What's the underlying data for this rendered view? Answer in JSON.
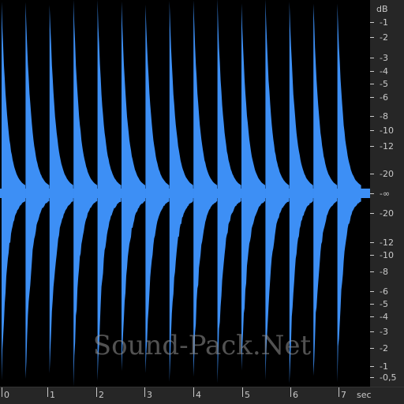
{
  "waveform": {
    "color": "#3d8ff5",
    "background": "#000000",
    "beat_count": 15
  },
  "db_ruler": {
    "unit": "dB",
    "labels": [
      "-1",
      "-2",
      "-3",
      "-4",
      "-5",
      "-6",
      "-8",
      "-10",
      "-12",
      "-20",
      "-∞",
      "-20",
      "-12",
      "-10",
      "-8",
      "-6",
      "-5",
      "-4",
      "-3",
      "-2",
      "-1",
      "-0,5"
    ]
  },
  "time_ruler": {
    "unit": "sec",
    "labels": [
      "0",
      "1",
      "2",
      "3",
      "4",
      "5",
      "6",
      "7"
    ]
  },
  "watermark": {
    "text": "Sound-Pack.Net"
  }
}
